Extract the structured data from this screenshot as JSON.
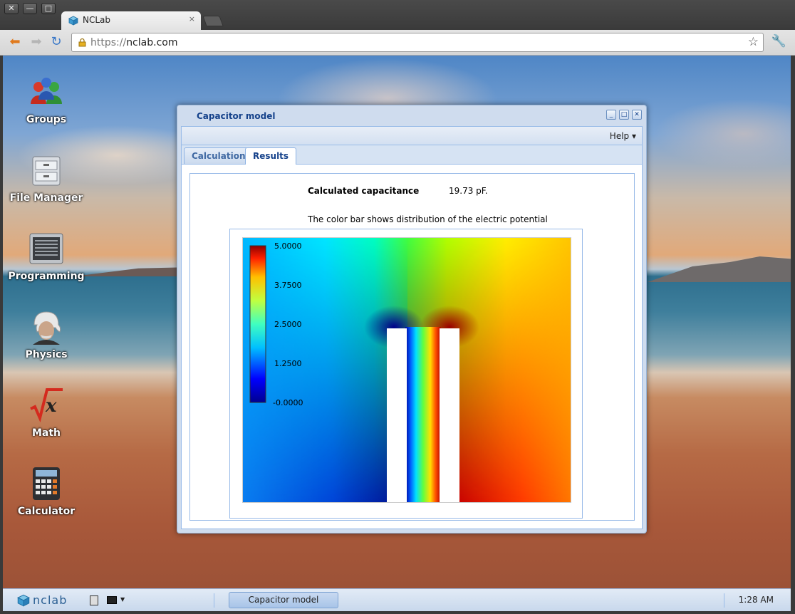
{
  "browser": {
    "tab_title": "NCLab",
    "tab_close": "×",
    "url_scheme": "https://",
    "url_host": "nclab.com",
    "controls": {
      "close": "✕",
      "minimize": "—",
      "maximize": "□"
    }
  },
  "desktop": {
    "icons": [
      {
        "label": "Groups",
        "icon": "groups-icon"
      },
      {
        "label": "File Manager",
        "icon": "file-cabinet-icon"
      },
      {
        "label": "Programming",
        "icon": "binary-terminal-icon"
      },
      {
        "label": "Physics",
        "icon": "einstein-portrait-icon"
      },
      {
        "label": "Math",
        "icon": "square-root-x-icon"
      },
      {
        "label": "Calculator",
        "icon": "calculator-icon"
      }
    ]
  },
  "window": {
    "title": "Capacitor model",
    "menu": {
      "help": "Help ▾"
    },
    "tabs": [
      {
        "label": "Calculation",
        "active": false
      },
      {
        "label": "Results",
        "active": true
      }
    ],
    "results": {
      "capacitance_label": "Calculated capacitance",
      "capacitance_colon": ":",
      "capacitance_value": "19.73 pF.",
      "description": "The color bar shows distribution of the electric potential",
      "colorbar_ticks": [
        "5.0000",
        "3.7500",
        "2.5000",
        "1.2500",
        "-0.0000"
      ]
    }
  },
  "taskbar": {
    "logo_text": "nclab",
    "task_button": "Capacitor model",
    "clock": "1:28 AM"
  },
  "colors": {
    "window_title": "#15428b",
    "window_border": "#99bbe8",
    "taskbar_bg": "#d6e3f3"
  }
}
